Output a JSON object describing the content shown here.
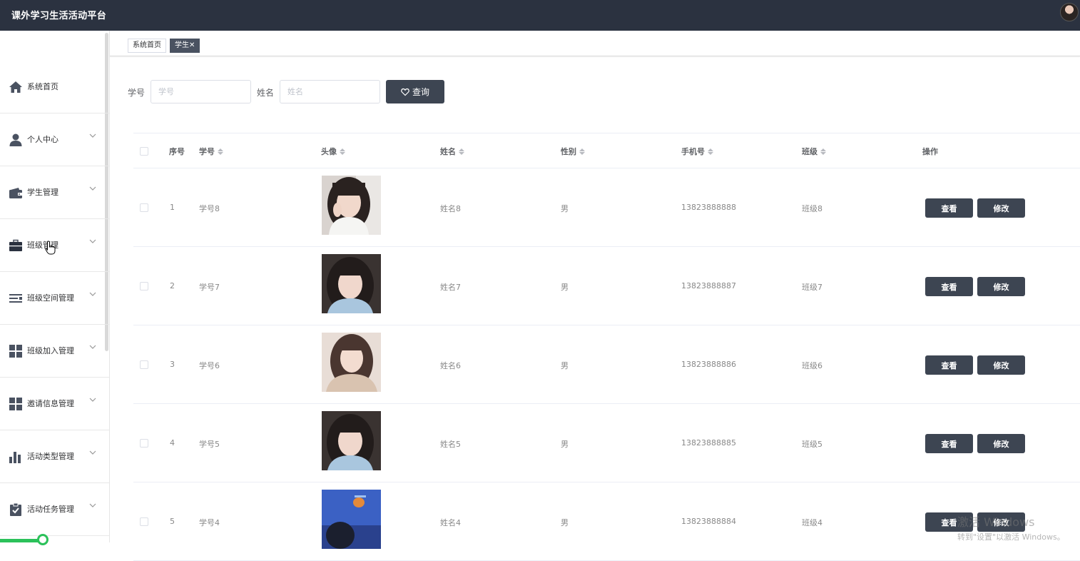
{
  "app": {
    "title": "课外学习生活活动平台"
  },
  "tabs": [
    {
      "label": "系统首页"
    },
    {
      "label": "学生✕"
    }
  ],
  "sidebar": {
    "items": [
      {
        "label": "系统首页",
        "icon": "home-icon"
      },
      {
        "label": "个人中心",
        "icon": "user-icon"
      },
      {
        "label": "学生管理",
        "icon": "wallet-icon"
      },
      {
        "label": "班级管理",
        "icon": "briefcase-icon"
      },
      {
        "label": "班级空间管理",
        "icon": "menu-lines-icon"
      },
      {
        "label": "班级加入管理",
        "icon": "grid-icon"
      },
      {
        "label": "邀请信息管理",
        "icon": "grid-icon"
      },
      {
        "label": "活动类型管理",
        "icon": "bar-chart-icon"
      },
      {
        "label": "活动任务管理",
        "icon": "clipboard-check-icon"
      }
    ]
  },
  "search": {
    "student_no_label": "学号",
    "student_no_placeholder": "学号",
    "name_label": "姓名",
    "name_placeholder": "姓名",
    "query_label": "查询"
  },
  "table": {
    "headers": {
      "index": "序号",
      "student_no": "学号",
      "avatar": "头像",
      "name": "姓名",
      "gender": "性别",
      "phone": "手机号",
      "class": "班级",
      "actions": "操作"
    },
    "rows": [
      {
        "index": "1",
        "student_no": "学号8",
        "name": "姓名8",
        "gender": "男",
        "phone": "13823888888",
        "class": "班级8"
      },
      {
        "index": "2",
        "student_no": "学号7",
        "name": "姓名7",
        "gender": "男",
        "phone": "13823888887",
        "class": "班级7"
      },
      {
        "index": "3",
        "student_no": "学号6",
        "name": "姓名6",
        "gender": "男",
        "phone": "13823888886",
        "class": "班级6"
      },
      {
        "index": "4",
        "student_no": "学号5",
        "name": "姓名5",
        "gender": "男",
        "phone": "13823888885",
        "class": "班级5"
      },
      {
        "index": "5",
        "student_no": "学号4",
        "name": "姓名4",
        "gender": "男",
        "phone": "13823888884",
        "class": "班级4"
      }
    ],
    "view_label": "查看",
    "edit_label": "修改"
  },
  "watermark": {
    "line1": "激活 Windows",
    "line2": "转到\"设置\"以激活 Windows。"
  },
  "colors": {
    "topbar": "#2b3240",
    "button": "#3d4552",
    "active_tab": "#4a5261"
  }
}
